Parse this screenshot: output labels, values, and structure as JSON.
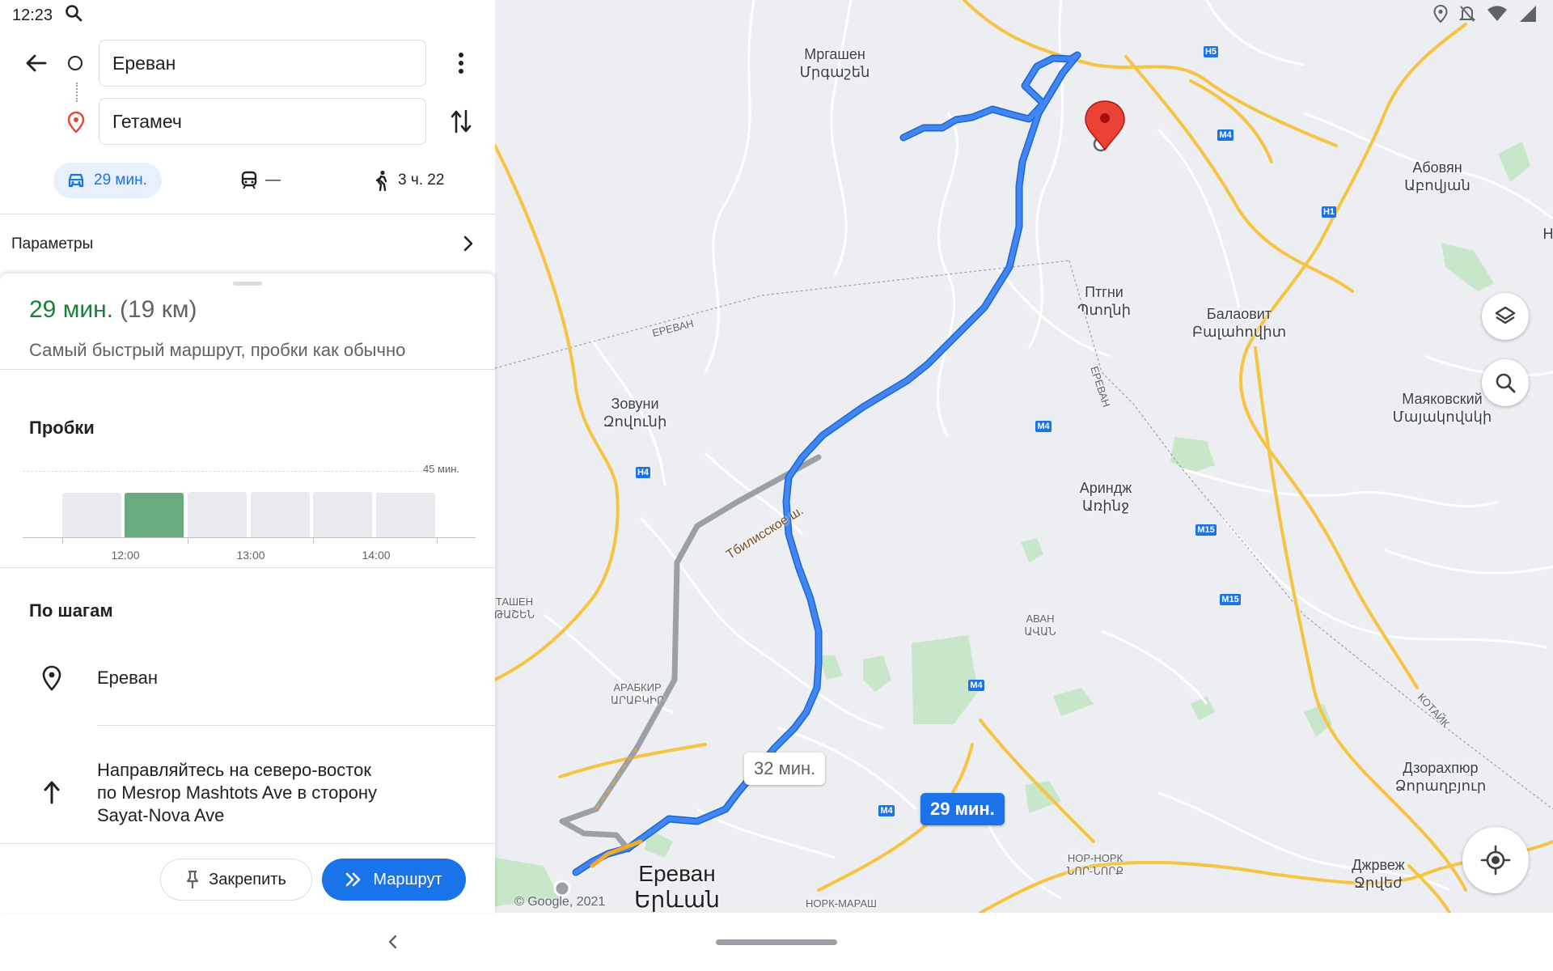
{
  "status": {
    "time": "12:23",
    "icons": [
      "search-icon",
      "location-icon",
      "do-not-disturb-icon",
      "wifi-icon",
      "signal-icon"
    ]
  },
  "directions": {
    "origin": "Ереван",
    "destination": "Гетамеч",
    "modes": [
      {
        "name": "drive",
        "label": "29 мин.",
        "selected": true
      },
      {
        "name": "transit",
        "label": "—",
        "selected": false
      },
      {
        "name": "walk",
        "label": "3 ч. 22",
        "selected": false
      }
    ],
    "params_label": "Параметры"
  },
  "summary": {
    "time": "29 мин.",
    "distance": "(19 км)",
    "description": "Самый быстрый маршрут, пробки как обычно"
  },
  "traffic": {
    "title": "Пробки",
    "max_label": "45 мин.",
    "tick_labels": [
      "12:00",
      "13:00",
      "14:00"
    ],
    "bars": [
      {
        "level": 0.46,
        "current": false
      },
      {
        "level": 0.46,
        "current": true
      },
      {
        "level": 0.47,
        "current": false
      },
      {
        "level": 0.47,
        "current": false
      },
      {
        "level": 0.47,
        "current": false
      },
      {
        "level": 0.46,
        "current": false
      }
    ]
  },
  "steps": {
    "title": "По шагам",
    "items": [
      {
        "icon": "place-icon",
        "text": "Ереван"
      },
      {
        "icon": "straight-arrow-icon",
        "lines": [
          "Направляйтесь на северо-восток",
          "по Mesrop Mashtots Ave в сторону",
          "Sayat-Nova Ave"
        ]
      }
    ]
  },
  "actions": {
    "pin_label": "Закрепить",
    "route_label": "Маршрут"
  },
  "map": {
    "labels": {
      "mrgashen_ru": "Мргашен",
      "mrgashen_am": "Մրգաշեն",
      "abovyan_ru": "Абовян",
      "abovyan_am": "Աբովյան",
      "ptghni_ru": "Птгни",
      "ptghni_am": "Պտղնի",
      "balaovit_ru": "Балаовит",
      "balaovit_am": "Բալահովիտ",
      "zovuni_ru": "Зовуни",
      "zovuni_am": "Զովունի",
      "mayakovsky_ru": "Маяковский",
      "mayakovsky_am": "Մայակովսկի",
      "arinj_ru": "Ариндж",
      "arinj_am": "Առինջ",
      "avan_ru": "Аван",
      "avan_am": "Ավան",
      "arabkir_ru": "Арабкир",
      "arabkir_am": "Արաբկիր",
      "ajapnyak_ru": "ташен",
      "ajapnyak_am": "թաշեն",
      "dzoraghbyur_ru": "Дзорахпюр",
      "dzoraghbyur_am": "Ձորաղբյուր",
      "jrvezh_ru": "Джрвеж",
      "jrvezh_am": "Ջրվեժ",
      "nork_ru": "Нор-Норк",
      "nork_am": "Նոր-Նորք",
      "nork_marash": "Норк-Мараш",
      "yerevan_ru": "Ереван",
      "yerevan_am": "Երևան",
      "yerevan_boundary_1": "ЕРЕВАН",
      "yerevan_boundary_2": "ЕРЕВАН",
      "kotayk": "КОТАЙК",
      "tbilisi_hwy": "Тбилисское ш.",
      "edge_letter": "Н"
    },
    "road_shields": [
      "H5",
      "M4",
      "H1",
      "M4",
      "H4",
      "M15",
      "M15",
      "M4",
      "M4"
    ],
    "route_chip_alt": "32 мин.",
    "route_chip_main": "29 мин.",
    "copyright": "© Google, 2021",
    "colors": {
      "route": "#4285f4",
      "route_alt": "#9aa0a6",
      "highway": "#f6c343",
      "park": "#c8e6c9",
      "marker": "#ea4335"
    }
  }
}
